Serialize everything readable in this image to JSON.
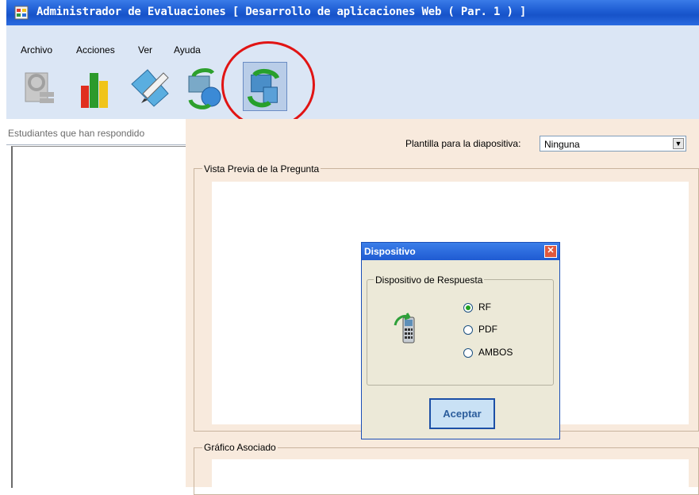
{
  "window": {
    "title": "Administrador de Evaluaciones [ Desarrollo de aplicaciones Web ( Par. 1 ) ]"
  },
  "menu": [
    "Archivo",
    "Acciones",
    "Ver",
    "Ayuda"
  ],
  "toolbar": {
    "buttons": [
      "search-report-icon",
      "bar-chart-icon",
      "edit-pen-icon",
      "globe-sync-icon",
      "device-sync-icon"
    ]
  },
  "left_panel": {
    "header": "Estudiantes que han respondido"
  },
  "main": {
    "plantilla_label": "Plantilla para la diapositiva:",
    "plantilla_value": "Ninguna",
    "preview_title": "Vista Previa de la Pregunta",
    "grafico_title": "Gráfico Asociado"
  },
  "dialog": {
    "title": "Dispositivo",
    "group_title": "Dispositivo de Respuesta",
    "options": [
      "RF",
      "PDF",
      "AMBOS"
    ],
    "selected": "RF",
    "accept_label": "Aceptar"
  },
  "colors": {
    "titlebar": "#1f5ed4",
    "menubar": "#dbe6f5",
    "panel": "#f8eadd",
    "highlight_ring": "#e11414"
  }
}
